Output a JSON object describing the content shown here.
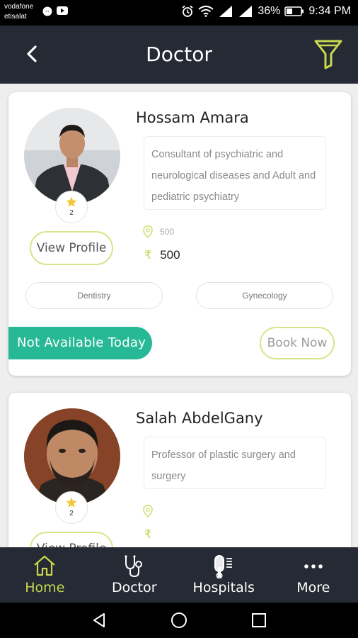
{
  "status_bar": {
    "carrier_line1": "vodafone",
    "carrier_line2": "etisalat",
    "battery": "36%",
    "time": "9:34 PM"
  },
  "app_bar": {
    "title": "Doctor",
    "back_icon": "arrow-left-icon",
    "filter_icon": "filter-funnel-icon"
  },
  "doctors": [
    {
      "name": "Hossam Amara",
      "description": "Consultant of psychiatric and neurological diseases and Adult and pediatric psychiatry",
      "rating_count": "2",
      "location": "500",
      "price": "500",
      "view_profile_label": "View Profile",
      "specialties": [
        "Dentistry",
        "Gynecology"
      ],
      "availability": "Not Available Today",
      "book_label": "Book Now"
    },
    {
      "name": "Salah AbdelGany",
      "description": "Professor of plastic surgery and surgery",
      "rating_count": "2",
      "location": "",
      "price": "",
      "view_profile_label": "View Profile"
    }
  ],
  "bottom_nav": [
    {
      "label": "Home",
      "icon": "home-icon",
      "active": true
    },
    {
      "label": "Doctor",
      "icon": "stethoscope-icon",
      "active": false
    },
    {
      "label": "Hospitals",
      "icon": "hospital-icon",
      "active": false
    },
    {
      "label": "More",
      "icon": "more-dots-icon",
      "active": false
    }
  ],
  "colors": {
    "accent_lime": "#c9d84f",
    "teal": "#27b896",
    "app_bar": "#252a34",
    "star": "#f2c83b"
  }
}
